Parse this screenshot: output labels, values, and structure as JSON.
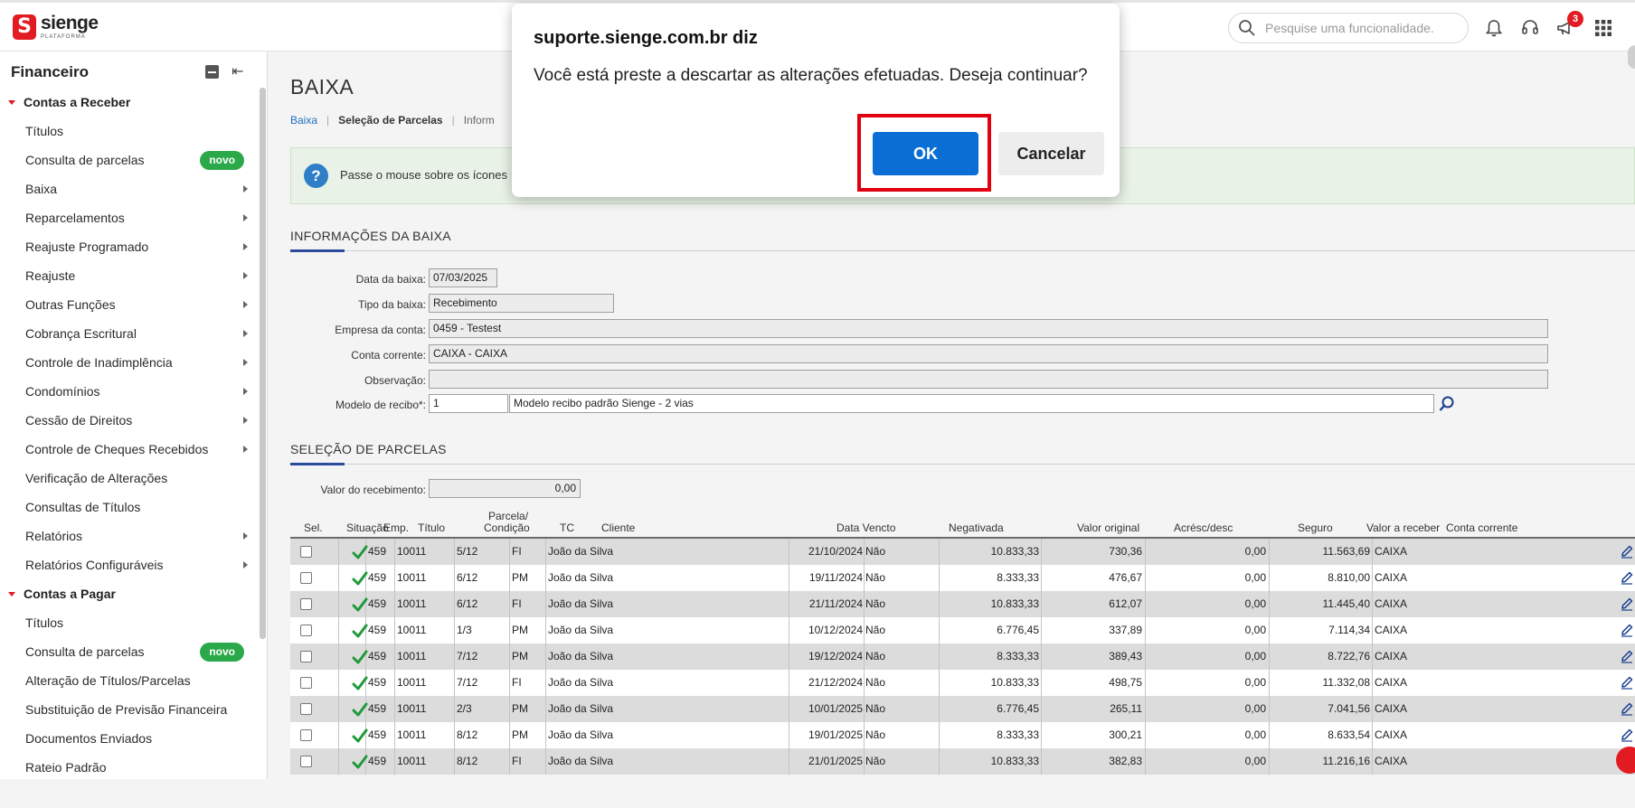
{
  "brand": {
    "name": "sienge",
    "sub": "PLATAFORMA",
    "mark": "S"
  },
  "topbar": {
    "search_placeholder": "Pesquise uma funcionalidade.",
    "notification_count": "3"
  },
  "sidebar": {
    "title": "Financeiro",
    "items": [
      {
        "label": "Contas a Receber",
        "type": "section"
      },
      {
        "label": "Títulos"
      },
      {
        "label": "Consulta de parcelas",
        "badge": "novo"
      },
      {
        "label": "Baixa",
        "arrow": true
      },
      {
        "label": "Reparcelamentos",
        "arrow": true
      },
      {
        "label": "Reajuste Programado",
        "arrow": true
      },
      {
        "label": "Reajuste",
        "arrow": true
      },
      {
        "label": "Outras Funções",
        "arrow": true
      },
      {
        "label": "Cobrança Escritural",
        "arrow": true
      },
      {
        "label": "Controle de Inadimplência",
        "arrow": true
      },
      {
        "label": "Condomínios",
        "arrow": true
      },
      {
        "label": "Cessão de Direitos",
        "arrow": true
      },
      {
        "label": "Controle de Cheques Recebidos",
        "arrow": true
      },
      {
        "label": "Verificação de Alterações"
      },
      {
        "label": "Consultas de Títulos"
      },
      {
        "label": "Relatórios",
        "arrow": true
      },
      {
        "label": "Relatórios Configuráveis",
        "arrow": true
      },
      {
        "label": "Contas a Pagar",
        "type": "section"
      },
      {
        "label": "Títulos"
      },
      {
        "label": "Consulta de parcelas",
        "badge": "novo"
      },
      {
        "label": "Alteração de Títulos/Parcelas"
      },
      {
        "label": "Substituição de Previsão Financeira"
      },
      {
        "label": "Documentos Enviados"
      },
      {
        "label": "Rateio Padrão"
      }
    ]
  },
  "page": {
    "title": "BAIXA",
    "breadcrumb": {
      "link": "Baixa",
      "current": "Seleção de Parcelas",
      "next": "Inform"
    },
    "info_text": "Passe o mouse sobre os ícones",
    "section_info": "INFORMAÇÕES DA BAIXA",
    "section_parcelas": "SELEÇÃO DE PARCELAS"
  },
  "form": {
    "data_baixa": {
      "label": "Data da baixa:",
      "value": "07/03/2025"
    },
    "tipo_baixa": {
      "label": "Tipo da baixa:",
      "value": "Recebimento"
    },
    "empresa": {
      "label": "Empresa da conta:",
      "value": "0459 - Testest"
    },
    "conta": {
      "label": "Conta corrente:",
      "value": "CAIXA - CAIXA"
    },
    "observacao": {
      "label": "Observação:",
      "value": ""
    },
    "modelo": {
      "label": "Modelo de recibo*:",
      "code": "1",
      "desc": "Modelo recibo padrão Sienge - 2 vias"
    },
    "valor_recebimento": {
      "label": "Valor do recebimento:",
      "value": "0,00"
    }
  },
  "table": {
    "headers": {
      "sel": "Sel.",
      "situacao": "Situação",
      "emp": "Emp.",
      "titulo": "Título",
      "parcela": "Parcela/",
      "parcela2": "Condição",
      "tc": "TC",
      "cliente": "Cliente",
      "vencto": "Data Vencto",
      "negativada": "Negativada",
      "valor_original": "Valor original",
      "acresc": "Acrésc/desc",
      "seguro": "Seguro",
      "valor_receber": "Valor a receber",
      "conta": "Conta corrente"
    },
    "rows": [
      {
        "emp": "459",
        "titulo": "10011",
        "parcela": "5/12",
        "tc": "FI",
        "cliente": "João da Silva",
        "vencto": "21/10/2024",
        "negativada": "Não",
        "original": "10.833,33",
        "acresc": "730,36",
        "seguro": "0,00",
        "receber": "11.563,69",
        "conta": "CAIXA"
      },
      {
        "emp": "459",
        "titulo": "10011",
        "parcela": "6/12",
        "tc": "PM",
        "cliente": "João da Silva",
        "vencto": "19/11/2024",
        "negativada": "Não",
        "original": "8.333,33",
        "acresc": "476,67",
        "seguro": "0,00",
        "receber": "8.810,00",
        "conta": "CAIXA"
      },
      {
        "emp": "459",
        "titulo": "10011",
        "parcela": "6/12",
        "tc": "FI",
        "cliente": "João da Silva",
        "vencto": "21/11/2024",
        "negativada": "Não",
        "original": "10.833,33",
        "acresc": "612,07",
        "seguro": "0,00",
        "receber": "11.445,40",
        "conta": "CAIXA"
      },
      {
        "emp": "459",
        "titulo": "10011",
        "parcela": "1/3",
        "tc": "PM",
        "cliente": "João da Silva",
        "vencto": "10/12/2024",
        "negativada": "Não",
        "original": "6.776,45",
        "acresc": "337,89",
        "seguro": "0,00",
        "receber": "7.114,34",
        "conta": "CAIXA"
      },
      {
        "emp": "459",
        "titulo": "10011",
        "parcela": "7/12",
        "tc": "PM",
        "cliente": "João da Silva",
        "vencto": "19/12/2024",
        "negativada": "Não",
        "original": "8.333,33",
        "acresc": "389,43",
        "seguro": "0,00",
        "receber": "8.722,76",
        "conta": "CAIXA"
      },
      {
        "emp": "459",
        "titulo": "10011",
        "parcela": "7/12",
        "tc": "FI",
        "cliente": "João da Silva",
        "vencto": "21/12/2024",
        "negativada": "Não",
        "original": "10.833,33",
        "acresc": "498,75",
        "seguro": "0,00",
        "receber": "11.332,08",
        "conta": "CAIXA"
      },
      {
        "emp": "459",
        "titulo": "10011",
        "parcela": "2/3",
        "tc": "PM",
        "cliente": "João da Silva",
        "vencto": "10/01/2025",
        "negativada": "Não",
        "original": "6.776,45",
        "acresc": "265,11",
        "seguro": "0,00",
        "receber": "7.041,56",
        "conta": "CAIXA"
      },
      {
        "emp": "459",
        "titulo": "10011",
        "parcela": "8/12",
        "tc": "PM",
        "cliente": "João da Silva",
        "vencto": "19/01/2025",
        "negativada": "Não",
        "original": "8.333,33",
        "acresc": "300,21",
        "seguro": "0,00",
        "receber": "8.633,54",
        "conta": "CAIXA"
      },
      {
        "emp": "459",
        "titulo": "10011",
        "parcela": "8/12",
        "tc": "FI",
        "cliente": "João da Silva",
        "vencto": "21/01/2025",
        "negativada": "Não",
        "original": "10.833,33",
        "acresc": "382,83",
        "seguro": "0,00",
        "receber": "11.216,16",
        "conta": "CAIXA"
      }
    ]
  },
  "dialog": {
    "title": "suporte.sienge.com.br diz",
    "message": "Você está preste a descartar as alterações efetuadas. Deseja continuar?",
    "ok_label": "OK",
    "cancel_label": "Cancelar"
  },
  "colors": {
    "brand_red": "#e21b23",
    "ok_blue": "#0b6ed5",
    "badge_green": "#2aa84a",
    "highlight_red": "#e0000f"
  }
}
